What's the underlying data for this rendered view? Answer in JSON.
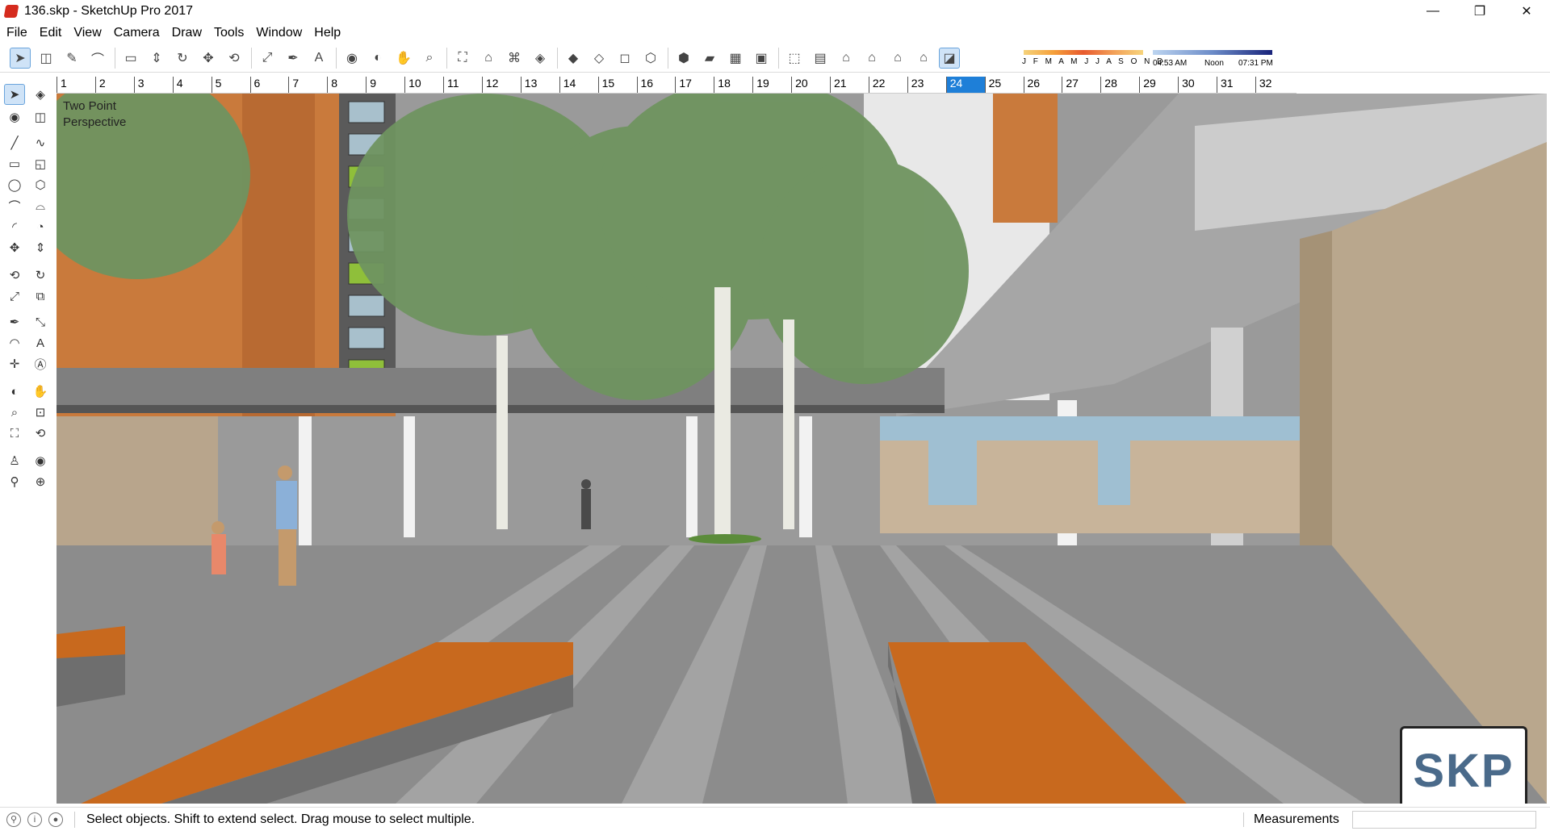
{
  "window": {
    "title": "136.skp - SketchUp Pro 2017",
    "icon": "sketchup-icon",
    "controls": {
      "minimize": "—",
      "maximize": "❐",
      "close": "✕"
    }
  },
  "menu": [
    "File",
    "Edit",
    "View",
    "Camera",
    "Draw",
    "Tools",
    "Window",
    "Help"
  ],
  "toolbar": {
    "icons": [
      "select-icon",
      "eraser-icon",
      "pencil-icon",
      "arc-icon",
      "rectangle-icon",
      "push-pull-icon",
      "follow-me-icon",
      "move-icon",
      "rotate-icon",
      "scale-icon",
      "tape-measure-icon",
      "text-icon",
      "paint-bucket-icon",
      "orbit-icon",
      "pan-icon",
      "zoom-icon",
      "zoom-extents-icon",
      "warehouse-icon",
      "extension-warehouse-icon",
      "components-icon",
      "ruby-icon",
      "xray-icon",
      "back-edges-icon",
      "wireframe-icon",
      "hidden-line-icon",
      "shaded-icon",
      "shaded-textures-icon",
      "monochrome-icon",
      "iso-view-icon",
      "top-view-icon",
      "front-view-icon",
      "right-view-icon",
      "back-view-icon",
      "left-view-icon",
      "shadows-icon"
    ],
    "shadow_settings": {
      "months": "J F M A M J J A S O N D",
      "time_start": "04:53 AM",
      "time_noon": "Noon",
      "time_end": "07:31 PM"
    }
  },
  "ruler": {
    "numbers": [
      "1",
      "2",
      "3",
      "4",
      "5",
      "6",
      "7",
      "8",
      "9",
      "10",
      "11",
      "12",
      "13",
      "14",
      "15",
      "16",
      "17",
      "18",
      "19",
      "20",
      "21",
      "22",
      "23",
      "24",
      "25",
      "26",
      "27",
      "28",
      "29",
      "30",
      "31",
      "32"
    ],
    "active": "24"
  },
  "left_toolbar": {
    "icons": [
      "select-icon",
      "component-icon",
      "paint-bucket-icon",
      "eraser-icon",
      "line-icon",
      "freehand-icon",
      "rectangle-icon",
      "rotated-rectangle-icon",
      "circle-icon",
      "polygon-icon",
      "arc-icon",
      "two-point-arc-icon",
      "three-point-arc-icon",
      "pie-icon",
      "move-icon",
      "push-pull-icon",
      "rotate-icon",
      "follow-me-icon",
      "scale-icon",
      "offset-icon",
      "tape-measure-icon",
      "dimension-icon",
      "protractor-icon",
      "text-icon",
      "axes-icon",
      "3d-text-icon",
      "orbit-icon",
      "pan-icon",
      "zoom-icon",
      "zoom-window-icon",
      "zoom-extents-icon",
      "previous-view-icon",
      "position-camera-icon",
      "look-around-icon",
      "walk-icon",
      "section-plane-icon"
    ]
  },
  "viewport": {
    "scene_label_line1": "Two Point",
    "scene_label_line2": "Perspective",
    "logo_text": "SKP"
  },
  "status": {
    "hint": "Select objects. Shift to extend select. Drag mouse to select multiple.",
    "measurements_label": "Measurements",
    "measurements_value": ""
  },
  "colors": {
    "accent": "#1e7fd8",
    "bench_wood": "#c8691e",
    "pavement": "#8c8c8c",
    "tree_green": "#6f9460",
    "brick": "#c87a3c",
    "stone_wall": "#bba991"
  }
}
